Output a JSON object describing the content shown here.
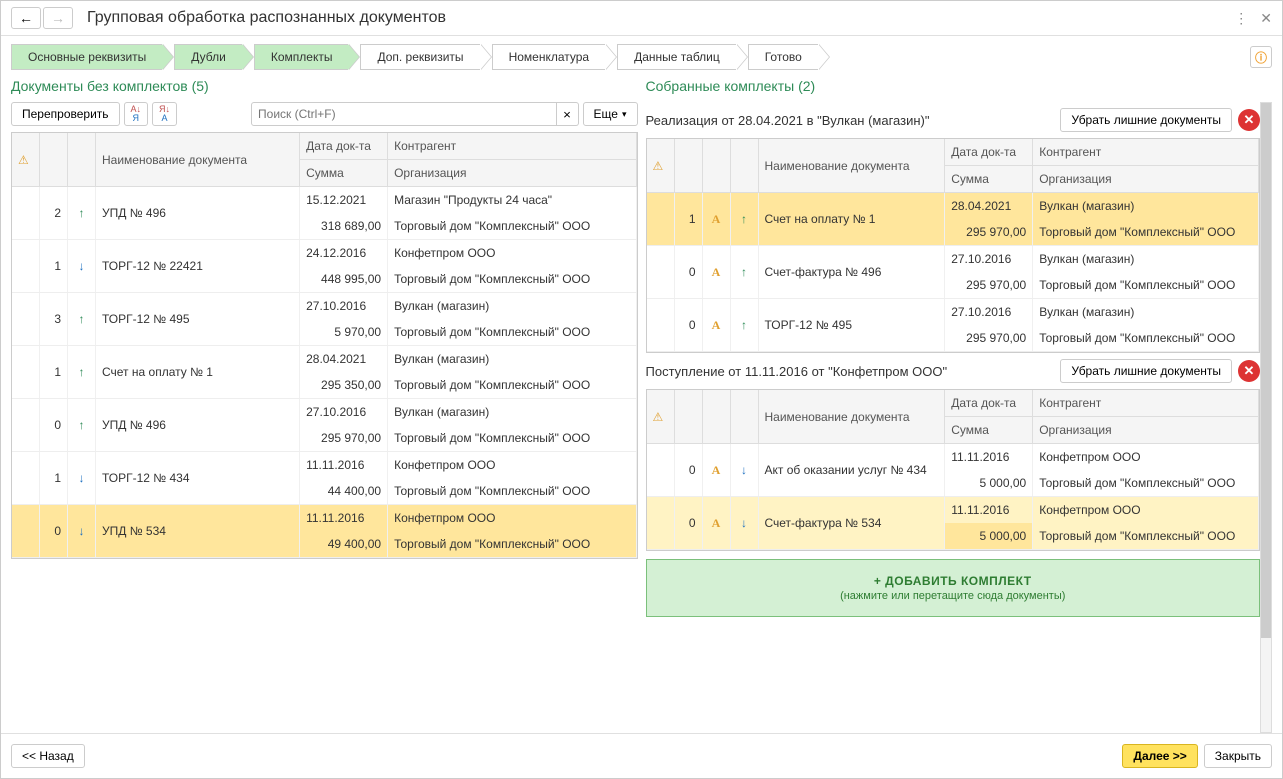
{
  "title": "Групповая обработка распознанных документов",
  "breadcrumb": [
    "Основные реквизиты",
    "Дубли",
    "Комплекты",
    "Доп. реквизиты",
    "Номенклатура",
    "Данные таблиц",
    "Готово"
  ],
  "left": {
    "title": "Документы без комплектов (5)",
    "recheck": "Перепроверить",
    "search_ph": "Поиск (Ctrl+F)",
    "more": "Еще",
    "head": {
      "name": "Наименование документа",
      "date": "Дата док-та",
      "sum": "Сумма",
      "contr": "Контрагент",
      "org": "Организация"
    },
    "rows": [
      {
        "n": "2",
        "dir": "up",
        "name": "УПД № 496",
        "date": "15.12.2021",
        "sum": "318 689,00",
        "contr": "Магазин \"Продукты 24 часа\"",
        "org": "Торговый дом \"Комплексный\" ООО"
      },
      {
        "n": "1",
        "dir": "down",
        "name": "ТОРГ-12 № 22421",
        "date": "24.12.2016",
        "sum": "448 995,00",
        "contr": "Конфетпром ООО",
        "org": "Торговый дом \"Комплексный\" ООО"
      },
      {
        "n": "3",
        "dir": "up",
        "name": "ТОРГ-12 № 495",
        "date": "27.10.2016",
        "sum": "5 970,00",
        "contr": "Вулкан (магазин)",
        "org": "Торговый дом \"Комплексный\" ООО"
      },
      {
        "n": "1",
        "dir": "up",
        "name": "Счет на оплату № 1",
        "date": "28.04.2021",
        "sum": "295 350,00",
        "contr": "Вулкан (магазин)",
        "org": "Торговый дом \"Комплексный\" ООО"
      },
      {
        "n": "0",
        "dir": "up",
        "name": "УПД № 496",
        "date": "27.10.2016",
        "sum": "295 970,00",
        "contr": "Вулкан (магазин)",
        "org": "Торговый дом \"Комплексный\" ООО"
      },
      {
        "n": "1",
        "dir": "down",
        "name": "ТОРГ-12 № 434",
        "date": "11.11.2016",
        "sum": "44 400,00",
        "contr": "Конфетпром ООО",
        "org": "Торговый дом \"Комплексный\" ООО"
      },
      {
        "n": "0",
        "dir": "down",
        "name": "УПД № 534",
        "date": "11.11.2016",
        "sum": "49 400,00",
        "contr": "Конфетпром ООО",
        "org": "Торговый дом \"Комплексный\" ООО",
        "hl": true
      }
    ]
  },
  "right": {
    "title": "Собранные комплекты (2)",
    "remove_extra": "Убрать лишние документы",
    "head": {
      "name": "Наименование документа",
      "date": "Дата док-та",
      "sum": "Сумма",
      "contr": "Контрагент",
      "org": "Организация"
    },
    "kits": [
      {
        "title": "Реализация от 28.04.2021 в \"Вулкан (магазин)\"",
        "rows": [
          {
            "n": "1",
            "sig": true,
            "dir": "up",
            "name": "Счет на оплату № 1",
            "date": "28.04.2021",
            "sum": "295 970,00",
            "contr": "Вулкан (магазин)",
            "org": "Торговый дом \"Комплексный\" ООО",
            "hl": true
          },
          {
            "n": "0",
            "sig": true,
            "dir": "up",
            "name": "Счет-фактура № 496",
            "date": "27.10.2016",
            "sum": "295 970,00",
            "contr": "Вулкан (магазин)",
            "org": "Торговый дом \"Комплексный\" ООО"
          },
          {
            "n": "0",
            "sig": true,
            "dir": "up",
            "name": "ТОРГ-12 № 495",
            "date": "27.10.2016",
            "sum": "295 970,00",
            "contr": "Вулкан (магазин)",
            "org": "Торговый дом \"Комплексный\" ООО"
          }
        ]
      },
      {
        "title": "Поступление от 11.11.2016 от \"Конфетпром ООО\"",
        "rows": [
          {
            "n": "0",
            "sig": true,
            "dir": "down",
            "name": "Акт об оказании услуг № 434",
            "date": "11.11.2016",
            "sum": "5 000,00",
            "contr": "Конфетпром ООО",
            "org": "Торговый дом \"Комплексный\" ООО"
          },
          {
            "n": "0",
            "sig": true,
            "dir": "down",
            "name": "Счет-фактура № 534",
            "date": "11.11.2016",
            "sum": "5 000,00",
            "contr": "Конфетпром ООО",
            "org": "Торговый дом \"Комплексный\" ООО",
            "hl_soft": true,
            "hl_sum": true
          }
        ]
      }
    ],
    "add_title": "+ ДОБАВИТЬ КОМПЛЕКТ",
    "add_sub": "(нажмите или перетащите сюда документы)"
  },
  "footer": {
    "back": "<< Назад",
    "next": "Далее >>",
    "close": "Закрыть"
  }
}
